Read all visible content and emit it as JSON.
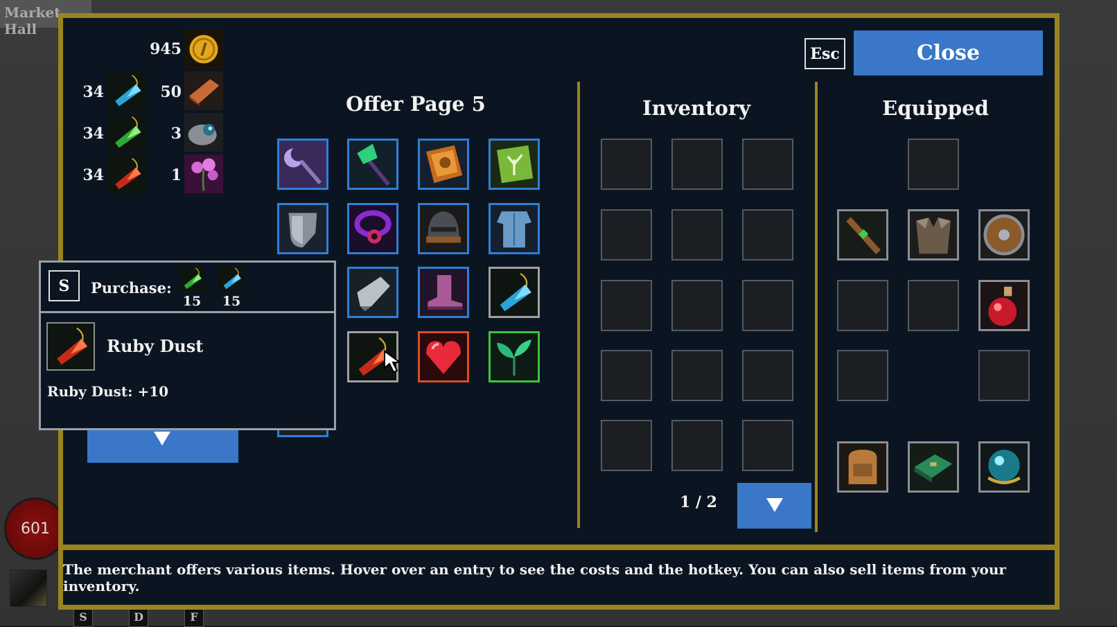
{
  "background": {
    "market_tab": "Market Hall",
    "health": "601",
    "hotkeys": [
      "S",
      "D",
      "F"
    ]
  },
  "resources": {
    "gold": "945",
    "rows": [
      {
        "left_value": "34",
        "left_icon": "blue-crystal-icon",
        "right_value": "50",
        "right_icon": "copper-bar-icon"
      },
      {
        "left_value": "34",
        "left_icon": "green-crystal-icon",
        "right_value": "3",
        "right_icon": "stone-orb-icon"
      },
      {
        "left_value": "34",
        "left_icon": "red-crystal-icon",
        "right_value": "1",
        "right_icon": "pink-flower-icon"
      }
    ]
  },
  "offer": {
    "title": "Offer Page 5",
    "items": [
      "crescent-staff-icon",
      "emerald-wand-icon",
      "spell-tome-icon",
      "tree-book-icon",
      "kite-shield-icon",
      "purple-amulet-icon",
      "iron-helmet-icon",
      "chest-armor-icon",
      "gauntlet-icon",
      "pink-boot-icon",
      "blue-crystal-icon",
      "red-crystal-icon",
      "heart-gem-icon",
      "leaf-sprout-icon"
    ]
  },
  "inventory": {
    "title": "Inventory",
    "page": "1 / 2"
  },
  "equipped": {
    "title": "Equipped",
    "items": [
      "wooden-staff-icon",
      "fur-armor-icon",
      "round-shield-icon",
      "red-potion-icon",
      "backpack-icon",
      "green-chest-icon",
      "crystal-orb-icon"
    ]
  },
  "buttons": {
    "esc": "Esc",
    "close": "Close"
  },
  "tooltip": {
    "hotkey": "S",
    "purchase_label": "Purchase:",
    "costs": [
      {
        "icon": "green-crystal-icon",
        "amount": "15"
      },
      {
        "icon": "blue-crystal-icon",
        "amount": "15"
      }
    ],
    "item_name": "Ruby Dust",
    "effect": "Ruby Dust: +10"
  },
  "footer": {
    "text": "The merchant offers various items. Hover over an entry to see the costs and the hotkey. You can also sell items from your inventory."
  },
  "colors": {
    "panel_bg": "#0b1521",
    "border_gold": "#9b8420",
    "button_blue": "#3a77c8",
    "slot_blue": "#2f7fd8"
  }
}
